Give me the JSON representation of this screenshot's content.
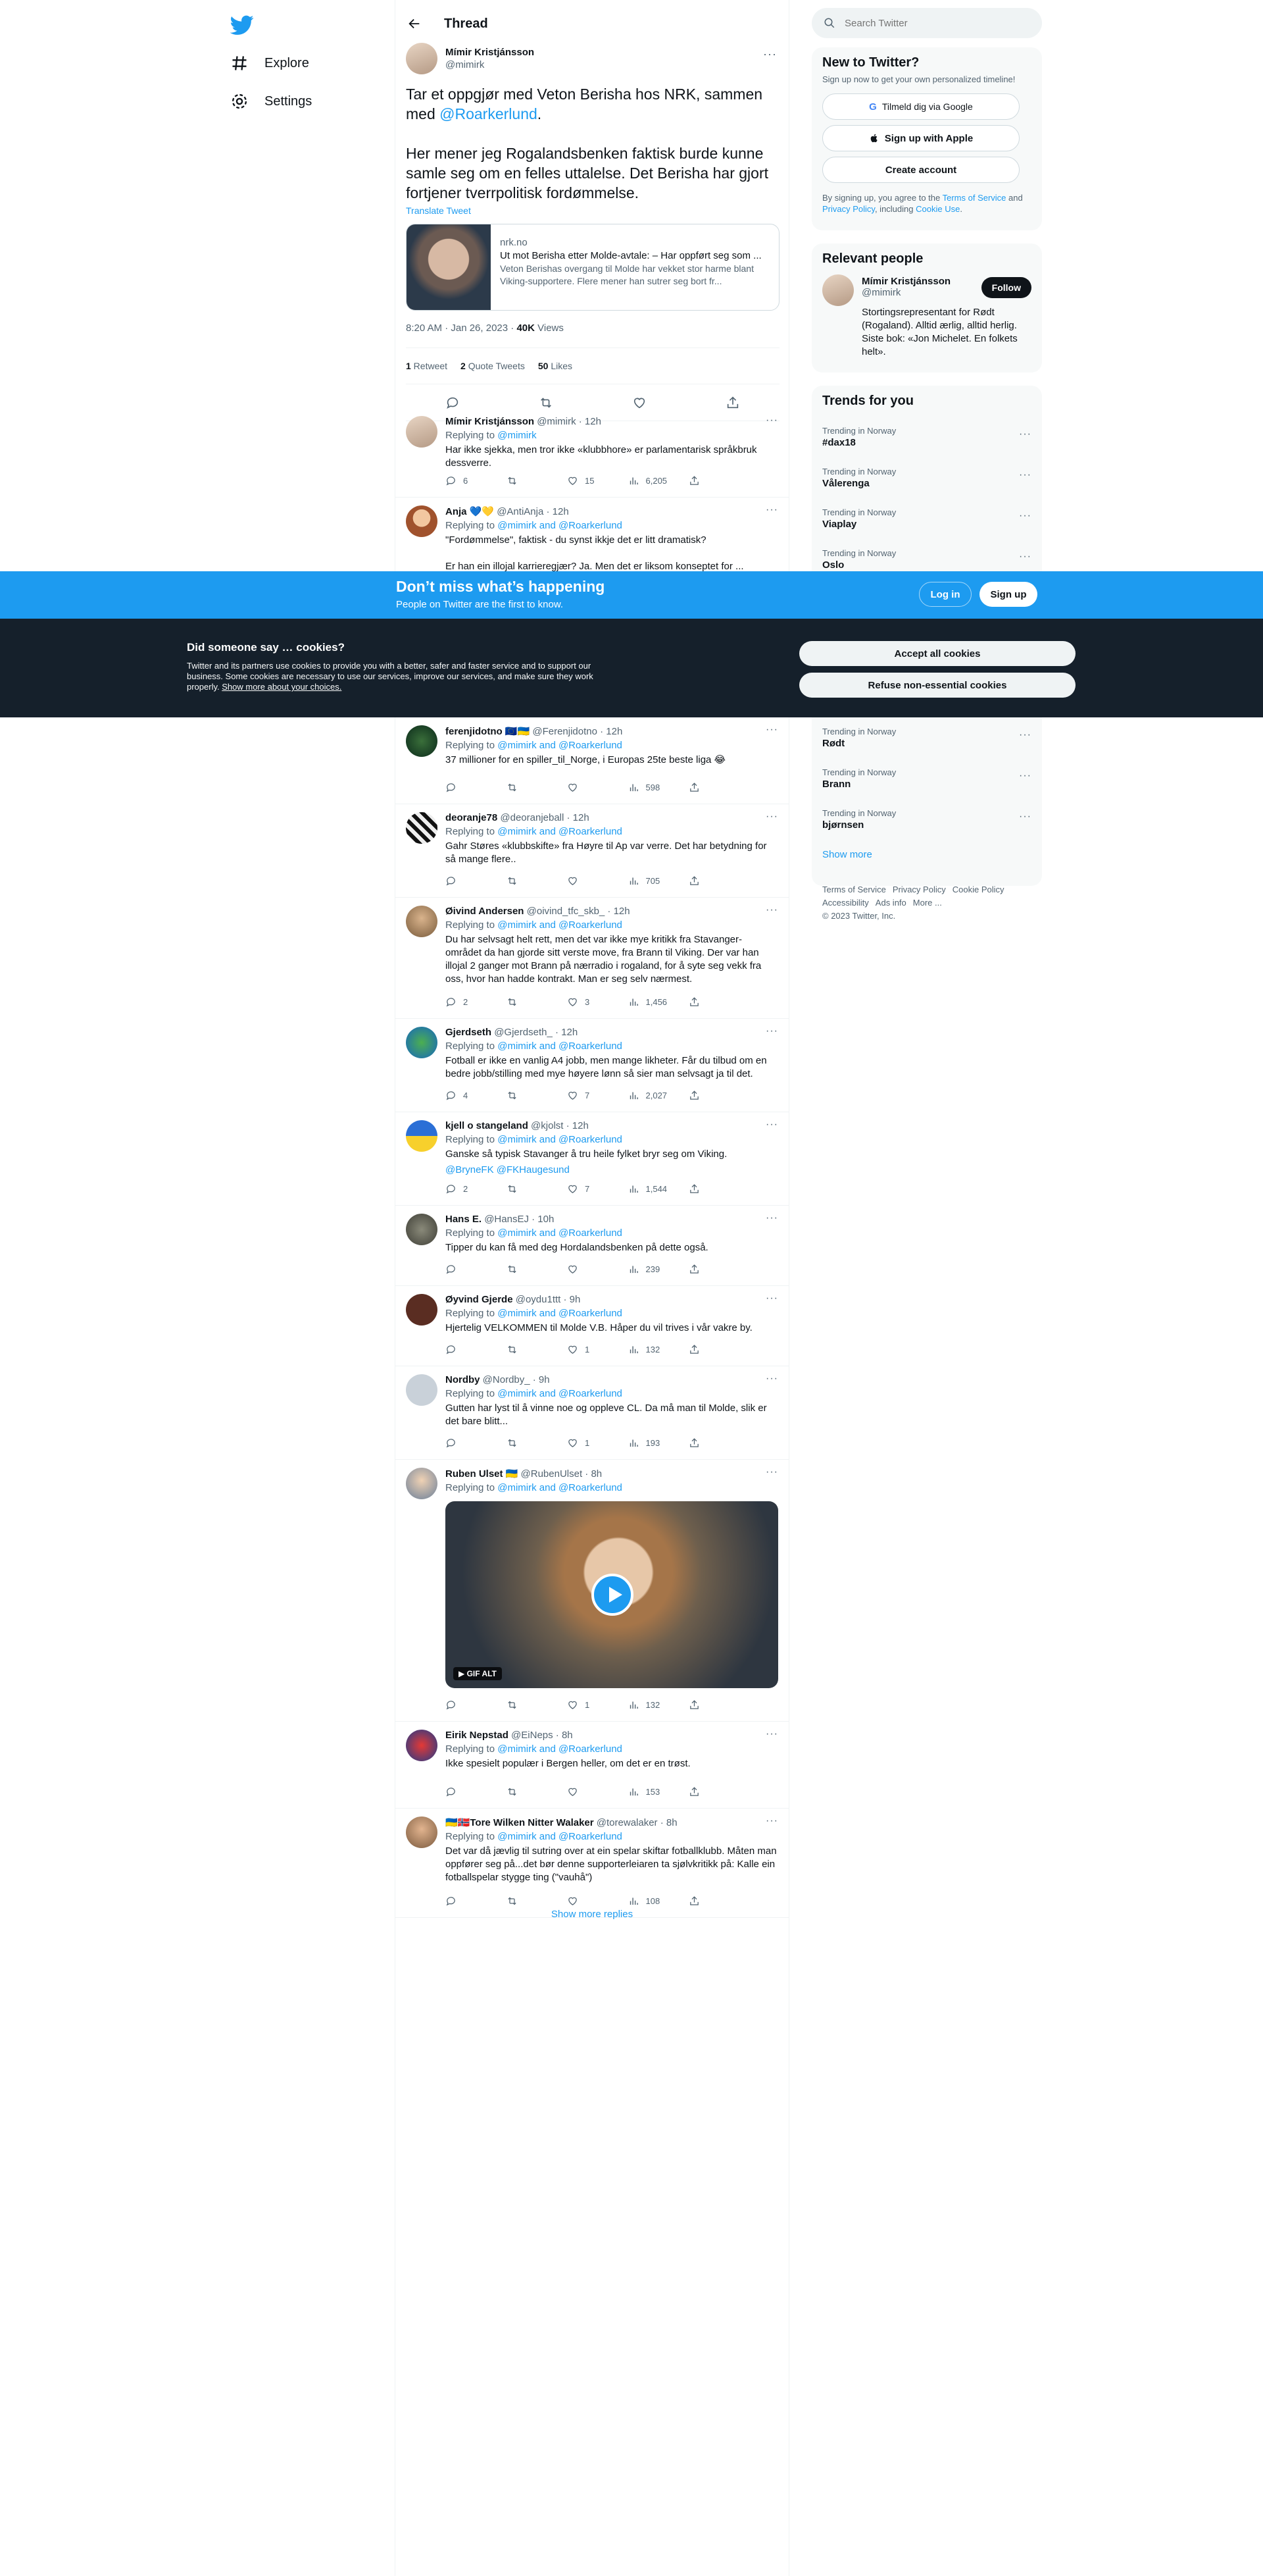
{
  "nav": {
    "items": [
      {
        "label": "Explore",
        "icon": "hashtag-icon"
      },
      {
        "label": "Settings",
        "icon": "gear-icon"
      }
    ]
  },
  "header": {
    "title": "Thread"
  },
  "focal": {
    "name": "Mímir Kristjánsson",
    "handle": "@mimirk",
    "text_before": "Tar et oppgjør med Veton Berisha hos NRK, sammen med ",
    "mention": "@Roarkerlund",
    "text_after": ".\n\nHer mener jeg Rogalandsbenken faktisk burde kunne samle seg om en felles uttalelse. Det Berisha har gjort fortjener tverrpolitisk fordømmelse.",
    "translate": "Translate Tweet",
    "card": {
      "domain": "nrk.no",
      "title": "Ut mot Berisha etter Molde-avtale: – Har oppført seg som ...",
      "desc": "Veton Berishas overgang til Molde har vekket stor harme blant Viking-supportere. Flere mener han sutrer seg bort fr..."
    },
    "time": "8:20 AM · Jan 26, 2023 · ",
    "views_count": "40K",
    "views_label": " Views",
    "retweets": "1",
    "retweets_label": " Retweet",
    "quotes": "2",
    "quotes_label": " Quote Tweets",
    "likes": "50",
    "likes_label": " Likes"
  },
  "replies": [
    {
      "name": "Mímir Kristjánsson",
      "handle": "@mimirk · 12h",
      "replying_prefix": "Replying to ",
      "replying_to": "@mimirk",
      "text": "Har ikke sjekka, men tror ikke «klubbhore» er parlamentarisk språkbruk dessverre.",
      "reply_count": "6",
      "retweet_count": "",
      "like_count": "15",
      "view_count": "6,205"
    },
    {
      "name": "Anja 💙💛",
      "handle": "@AntiAnja · 12h",
      "replying_prefix": "Replying to ",
      "replying_to": "@mimirk and @Roarkerlund",
      "text": "\"Fordømmelse\", faktisk - du synst ikkje det er litt dramatisk?\n\nEr han ein illojal karrieregjær? Ja. Men det er liksom konseptet for ...",
      "reply_count": "",
      "retweet_count": "",
      "like_count": "",
      "view_count": ""
    },
    {
      "name": "ferenjidotno 🇪🇺🇺🇦",
      "handle": "@Ferenjidotno · 12h",
      "replying_prefix": "Replying to ",
      "replying_to": "@mimirk and @Roarkerlund",
      "text": "37 millioner for en spiller_til_Norge, i Europas 25te beste liga 😂",
      "reply_count": "",
      "retweet_count": "",
      "like_count": "",
      "view_count": "598"
    },
    {
      "name": "deoranje78",
      "handle": "@deoranjeball · 12h",
      "replying_prefix": "Replying to ",
      "replying_to": "@mimirk and @Roarkerlund",
      "text": "Gahr Støres «klubbskifte» fra Høyre til Ap var verre. Det har betydning for så mange flere..",
      "reply_count": "",
      "retweet_count": "",
      "like_count": "",
      "view_count": "705"
    },
    {
      "name": "Øivind Andersen",
      "handle": "@oivind_tfc_skb_ · 12h",
      "replying_prefix": "Replying to ",
      "replying_to": "@mimirk and @Roarkerlund",
      "text": "Du har selvsagt helt rett, men det var ikke mye kritikk fra Stavanger-området da han gjorde sitt verste move, fra Brann til Viking. Der var han illojal 2 ganger mot Brann på nærradio i rogaland, for å syte seg vekk fra oss, hvor han hadde kontrakt. Man er seg selv nærmest.",
      "reply_count": "2",
      "retweet_count": "",
      "like_count": "3",
      "view_count": "1,456"
    },
    {
      "name": "Gjerdseth",
      "handle": "@Gjerdseth_ · 12h",
      "replying_prefix": "Replying to ",
      "replying_to": "@mimirk and @Roarkerlund",
      "text": "Fotball er ikke en vanlig A4 jobb, men mange likheter. Får du tilbud om en bedre jobb/stilling med mye høyere lønn så sier man selvsagt ja til det.",
      "reply_count": "4",
      "retweet_count": "",
      "like_count": "7",
      "view_count": "2,027"
    },
    {
      "name": "kjell o stangeland",
      "handle": "@kjolst · 12h",
      "replying_prefix": "Replying to ",
      "replying_to": "@mimirk and @Roarkerlund",
      "text": "Ganske så typisk Stavanger å tru heile fylket bryr seg om Viking.",
      "text_link": "@BryneFK @FKHaugesund",
      "reply_count": "2",
      "retweet_count": "",
      "like_count": "7",
      "view_count": "1,544"
    },
    {
      "name": "Hans E.",
      "handle": "@HansEJ · 10h",
      "replying_prefix": "Replying to ",
      "replying_to": "@mimirk and @Roarkerlund",
      "text": "Tipper du kan få med deg Hordalandsbenken på dette også.",
      "reply_count": "",
      "retweet_count": "",
      "like_count": "",
      "view_count": "239"
    },
    {
      "name": "Øyvind Gjerde",
      "handle": "@oydu1ttt · 9h",
      "replying_prefix": "Replying to ",
      "replying_to": "@mimirk and @Roarkerlund",
      "text": "Hjertelig VELKOMMEN til Molde V.B. Håper du vil trives i vår vakre by.",
      "reply_count": "",
      "retweet_count": "",
      "like_count": "1",
      "view_count": "132"
    },
    {
      "name": "Nordby",
      "handle": "@Nordby_ · 9h",
      "replying_prefix": "Replying to ",
      "replying_to": "@mimirk and @Roarkerlund",
      "text": "Gutten har lyst til å vinne noe og oppleve CL. Da må man til Molde, slik er det bare blitt...",
      "reply_count": "",
      "retweet_count": "",
      "like_count": "1",
      "view_count": "193"
    },
    {
      "name": "Ruben Ulset 🇺🇦",
      "handle": "@RubenUlset · 8h",
      "replying_prefix": "Replying to ",
      "replying_to": "@mimirk and @Roarkerlund",
      "text": "",
      "gif_badge": "▶  GIF  ALT",
      "reply_count": "",
      "retweet_count": "",
      "like_count": "1",
      "view_count": "132"
    },
    {
      "name": "Eirik Nepstad",
      "handle": "@EiNeps · 8h",
      "replying_prefix": "Replying to ",
      "replying_to": "@mimirk and @Roarkerlund",
      "text": "Ikke spesielt populær i Bergen heller, om det er en trøst.",
      "reply_count": "",
      "retweet_count": "",
      "like_count": "",
      "view_count": "153"
    },
    {
      "name": "🇺🇦🇳🇴Tore Wilken Nitter Walaker",
      "handle": "@torewalaker · 8h",
      "replying_prefix": "Replying to ",
      "replying_to": "@mimirk and @Roarkerlund",
      "text": "Det var då jævlig til sutring over at ein spelar skiftar fotballklubb. Måten man oppfører seg på...det bør denne supporterleiaren ta sjølvkritikk på: Kalle ein fotballspelar stygge ting (\"vauhå\")",
      "reply_count": "",
      "retweet_count": "",
      "like_count": "",
      "view_count": "108"
    }
  ],
  "show_more_replies": "Show more replies",
  "search": {
    "placeholder": "Search Twitter"
  },
  "new_to_twitter": {
    "title": "New to Twitter?",
    "sub": "Sign up now to get your own personalized timeline!",
    "google": "Tilmeld dig via Google",
    "apple": "Sign up with Apple",
    "create": "Create account",
    "legal_1": "By signing up, you agree to the ",
    "terms": "Terms of Service",
    "legal_2": " and ",
    "privacy": "Privacy Policy",
    "legal_3": ", including ",
    "cookie_use": "Cookie Use",
    "legal_4": "."
  },
  "relevant": {
    "title": "Relevant people",
    "name": "Mímir Kristjánsson",
    "handle": "@mimirk",
    "follow": "Follow",
    "bio": "Stortingsrepresentant for Rødt (Rogaland). Alltid ærlig, alltid herlig. Siste bok: «Jon Michelet. En folkets helt»."
  },
  "trends": {
    "title": "Trends for you",
    "items_top": [
      {
        "context": "Trending in Norway",
        "name": "#dax18"
      },
      {
        "context": "Trending in Norway",
        "name": "Vålerenga"
      },
      {
        "context": "Trending in Norway",
        "name": "Viaplay"
      },
      {
        "context": "Trending in Norway",
        "name": "Oslo"
      }
    ],
    "items_bottom": [
      {
        "context": "Trending in Norway",
        "name": "Rødt"
      },
      {
        "context": "Trending in Norway",
        "name": "Brann"
      },
      {
        "context": "Trending in Norway",
        "name": "bjørnsen"
      }
    ],
    "show_more": "Show more"
  },
  "footer": {
    "links_row1": [
      "Terms of Service",
      "Privacy Policy",
      "Cookie Policy"
    ],
    "links_row2": [
      "Accessibility",
      "Ads info",
      "More ..."
    ],
    "copyright": "© 2023 Twitter, Inc."
  },
  "loginbar": {
    "title": "Don’t miss what’s happening",
    "sub": "People on Twitter are the first to know.",
    "login": "Log in",
    "signup": "Sign up"
  },
  "cookie": {
    "title": "Did someone say … cookies?",
    "desc": "Twitter and its partners use cookies to provide you with a better, safer and faster service and to support our business. Some cookies are necessary to use our services, improve our services, and make sure they work properly. ",
    "link": "Show more about your choices.",
    "accept": "Accept all cookies",
    "refuse": "Refuse non-essential cookies"
  },
  "colors": {
    "accent": "#1d9bf0",
    "text": "#0f1419",
    "secondary": "#536471",
    "cookie_bg": "#15202b"
  }
}
